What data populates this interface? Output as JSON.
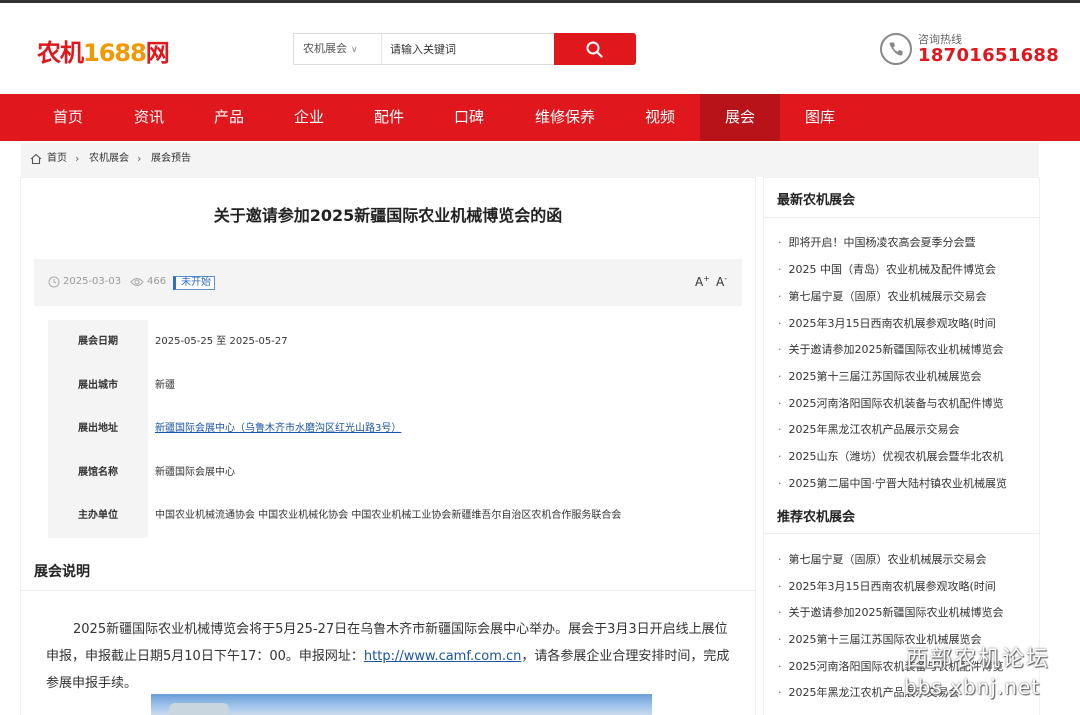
{
  "header": {
    "logo": {
      "part1": "农机",
      "part2": "1688",
      "part3": "网"
    },
    "search": {
      "category": "农机展会",
      "placeholder": "请输入关键词"
    },
    "hotline": {
      "label": "咨询热线",
      "number": "18701651688"
    }
  },
  "nav": {
    "items": [
      "首页",
      "资讯",
      "产品",
      "企业",
      "配件",
      "口碑",
      "维修保养",
      "视频",
      "展会",
      "图库"
    ],
    "active_index": 8
  },
  "breadcrumb": [
    "首页",
    "农机展会",
    "展会预告"
  ],
  "article": {
    "title": "关于邀请参加2025新疆国际农业机械博览会的函",
    "date": "2025-03-03",
    "views": "466",
    "status": "未开始",
    "font_larger": "A",
    "font_smaller": "A",
    "plus": "+",
    "minus": "-"
  },
  "info_rows": [
    {
      "key": "展会日期",
      "value": "2025-05-25 至 2025-05-27"
    },
    {
      "key": "展出城市",
      "value": "新疆"
    },
    {
      "key": "展出地址",
      "value": "新疆国际会展中心（乌鲁木齐市水磨沟区红光山路3号）"
    },
    {
      "key": "展馆名称",
      "value": "新疆国际会展中心"
    },
    {
      "key": "主办单位",
      "value": "中国农业机械流通协会 中国农业机械化协会 中国农业机械工业协会新疆维吾尔自治区农机合作服务联合会"
    }
  ],
  "description": {
    "title": "展会说明",
    "text_before": "2025新疆国际农业机械博览会将于5月25-27日在乌鲁木齐市新疆国际会展中心举办。展会于3月3日开启线上展位申报，申报截止日期5月10日下午17：00。申报网址：",
    "link": "http://www.camf.com.cn",
    "text_after": "，请各参展企业合理安排时间，完成参展申报手续。"
  },
  "sidebar": {
    "latest_title": "最新农机展会",
    "latest": [
      "即将开启！中国杨凌农高会夏季分会暨",
      "2025 中国（青岛）农业机械及配件博览会",
      "第七届宁夏（固原）农业机械展示交易会",
      "2025年3月15日西南农机展参观攻略(时间",
      "关于邀请参加2025新疆国际农业机械博览会",
      "2025第十三届江苏国际农业机械展览会",
      "2025河南洛阳国际农机装备与农机配件博览",
      "2025年黑龙江农机产品展示交易会",
      "2025山东（潍坊）优视农机展会暨华北农机",
      "2025第二届中国·宁晋大陆村镇农业机械展览"
    ],
    "recommend_title": "推荐农机展会",
    "recommend": [
      "第七届宁夏（固原）农业机械展示交易会",
      "2025年3月15日西南农机展参观攻略(时间",
      "关于邀请参加2025新疆国际农业机械博览会",
      "2025第十三届江苏国际农业机械展览会",
      "2025河南洛阳国际农机装备与农机配件博览",
      "2025年黑龙江农机产品展示交易会"
    ]
  },
  "watermark": {
    "line1": "西部农机论坛",
    "line2": "bbs.xbnj.net"
  },
  "colors": {
    "brand_red": "#e0181e",
    "nav_active": "#b81319",
    "link_blue": "#1a55a8",
    "panel_gray": "#f4f4f4"
  }
}
